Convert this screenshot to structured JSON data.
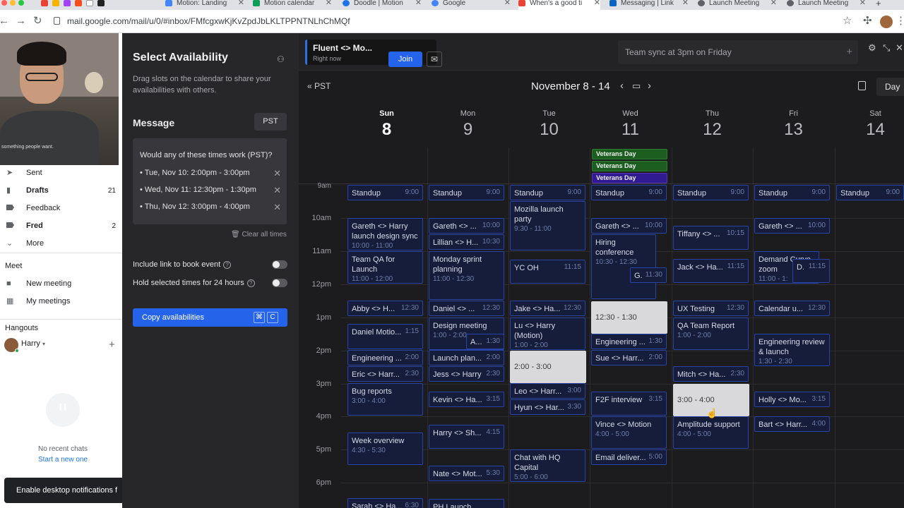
{
  "browser": {
    "tabs": [
      {
        "label": "Motion: Landing",
        "color": "#4285f4"
      },
      {
        "label": "Motion calendar",
        "color": "#0f9d58"
      },
      {
        "label": "Doodle | Motion",
        "color": "#1a73e8"
      },
      {
        "label": "Google",
        "color": "#4285f4"
      },
      {
        "label": "When's a good ti",
        "color": "#ea4335"
      },
      {
        "label": "Messaging | Link",
        "color": "#0a66c2"
      },
      {
        "label": "Launch Meeting",
        "color": "#5f6368"
      },
      {
        "label": "Launch Meeting",
        "color": "#5f6368"
      }
    ],
    "url": "mail.google.com/mail/u/0/#inbox/FMfcgxwKjKvZpdJbLKLTPPNTNLhChMQf"
  },
  "webcam": {
    "shirt_text": "something people want."
  },
  "gmail": {
    "nav": [
      {
        "label": "Sent",
        "count": "",
        "icon": "send-icon"
      },
      {
        "label": "Drafts",
        "count": "21",
        "icon": "draft-icon"
      },
      {
        "label": "Feedback",
        "count": "",
        "icon": "label-icon"
      },
      {
        "label": "Fred",
        "count": "2",
        "icon": "label-icon"
      },
      {
        "label": "More",
        "count": "",
        "icon": "chevron-down-icon"
      }
    ],
    "meet_title": "Meet",
    "meet_items": [
      {
        "label": "New meeting",
        "icon": "video-icon"
      },
      {
        "label": "My meetings",
        "icon": "calendar-icon"
      }
    ],
    "hangouts_title": "Hangouts",
    "hangouts_user": "Harry",
    "no_chats": "No recent chats",
    "start_new": "Start a new one",
    "toast": "Enable desktop notifications f"
  },
  "availability": {
    "title": "Select Availability",
    "description": "Drag slots on the calendar to share your availabilities with others.",
    "message_label": "Message",
    "timezone": "PST",
    "question": "Would any of these times work (PST)?",
    "slots": [
      "• Tue, Nov 10: 2:00pm - 3:00pm",
      "• Wed, Nov 11: 12:30pm - 1:30pm",
      "• Thu, Nov 12: 3:00pm - 4:00pm"
    ],
    "clear_all": "Clear all times",
    "include_link": "Include link to book event",
    "hold_times": "Hold selected times for 24 hours",
    "copy_button": "Copy availabilities",
    "kbd_cmd": "⌘",
    "kbd_c": "C"
  },
  "meeting_card": {
    "title": "Fluent <> Mo...",
    "subtitle": "Right now",
    "join": "Join"
  },
  "quick_input": {
    "placeholder": "Team sync at 3pm on Friday"
  },
  "calendar": {
    "timezone": "PST",
    "week_range": "November 8 - 14",
    "view": "Day",
    "days": [
      {
        "name": "Sun",
        "date": "8"
      },
      {
        "name": "Mon",
        "date": "9"
      },
      {
        "name": "Tue",
        "date": "10"
      },
      {
        "name": "Wed",
        "date": "11"
      },
      {
        "name": "Thu",
        "date": "12"
      },
      {
        "name": "Fri",
        "date": "13"
      },
      {
        "name": "Sat",
        "date": "14"
      }
    ],
    "hours": [
      "9am",
      "10am",
      "11am",
      "12pm",
      "1pm",
      "2pm",
      "3pm",
      "4pm",
      "5pm",
      "6pm"
    ],
    "all_day": [
      {
        "label": "Veterans Day",
        "color": "#1b5e20",
        "border": "#2e7d32"
      },
      {
        "label": "Veterans Day",
        "color": "#1b5e20",
        "border": "#2e7d32"
      },
      {
        "label": "Veterans Day",
        "color": "#311b92",
        "border": "#5e35b1"
      }
    ],
    "events": {
      "sun": [
        {
          "title": "Standup",
          "time": "9:00"
        },
        {
          "title": "Gareth <> Harry launch design sync",
          "time": "10:00 - 11:00"
        },
        {
          "title": "Team QA for Launch",
          "time": "11:00 - 12:00"
        },
        {
          "title": "Abby <> H...",
          "time": "12:30"
        },
        {
          "title": "Daniel Motio...",
          "time": "1:15"
        },
        {
          "title": "Engineering ...",
          "time": "2:00"
        },
        {
          "title": "Eric <> Harr...",
          "time": "2:30"
        },
        {
          "title": "Bug reports",
          "time": "3:00 - 4:00"
        },
        {
          "title": "Week overview",
          "time": "4:30 - 5:30"
        },
        {
          "title": "Sarah <> Ha...",
          "time": "6:30"
        }
      ],
      "mon": [
        {
          "title": "Standup",
          "time": "9:00"
        },
        {
          "title": "Gareth <> ...",
          "time": "10:00"
        },
        {
          "title": "Lillian <> H...",
          "time": "10:30"
        },
        {
          "title": "Monday sprint planning",
          "time": "11:00 - 12:30"
        },
        {
          "title": "Daniel <> ...",
          "time": "12:30"
        },
        {
          "title": "Design meeting",
          "time": "1:00 - 2:00"
        },
        {
          "title": "A...",
          "time": "1:30"
        },
        {
          "title": "Launch plan...",
          "time": "2:00"
        },
        {
          "title": "Jess <> Harry",
          "time": "2:30"
        },
        {
          "title": "Kevin <> Ha...",
          "time": "3:15"
        },
        {
          "title": "Harry <> Sh...",
          "time": "4:15"
        },
        {
          "title": "Nate <> Mot...",
          "time": "5:30"
        },
        {
          "title": "PH Launch",
          "time": ""
        }
      ],
      "tue": [
        {
          "title": "Standup",
          "time": "9:00"
        },
        {
          "title": "Mozilla launch party",
          "time": "9:30 - 11:00"
        },
        {
          "title": "YC OH",
          "time": "11:15"
        },
        {
          "title": "Jake <> Ha...",
          "time": "12:30"
        },
        {
          "title": "Lu <> Harry (Motion)",
          "time": "1:00 - 2:00"
        },
        {
          "title": "2:00 - 3:00",
          "time": ""
        },
        {
          "title": "Leo <> Harr...",
          "time": "3:00"
        },
        {
          "title": "Hyun <> Har...",
          "time": "3:30"
        },
        {
          "title": "Chat with HQ Capital",
          "time": "5:00 - 6:00"
        }
      ],
      "wed": [
        {
          "title": "Standup",
          "time": "9:00"
        },
        {
          "title": "Gareth <> ...",
          "time": "10:00"
        },
        {
          "title": "Hiring conference",
          "time": "10:30 - 12:30"
        },
        {
          "title": "G.",
          "time": "11:30"
        },
        {
          "title": "12:30 - 1:30",
          "time": ""
        },
        {
          "title": "Engineering ...",
          "time": "1:30"
        },
        {
          "title": "Sue <> Harr...",
          "time": "2:00"
        },
        {
          "title": "F2F interview",
          "time": "3:15"
        },
        {
          "title": "Vince <> Motion",
          "time": "4:00 - 5:00"
        },
        {
          "title": "Email deliver...",
          "time": "5:00"
        }
      ],
      "thu": [
        {
          "title": "Standup",
          "time": "9:00"
        },
        {
          "title": "Tiffany <> ...",
          "time": "10:15"
        },
        {
          "title": "Jack <> Ha...",
          "time": "11:15"
        },
        {
          "title": "UX Testing",
          "time": "12:30"
        },
        {
          "title": "QA Team Report",
          "time": "1:00 - 2:00"
        },
        {
          "title": "Mitch <> Ha...",
          "time": "2:30"
        },
        {
          "title": "3:00 - 4:00",
          "time": ""
        },
        {
          "title": "Amplitude support",
          "time": "4:00 - 5:00"
        }
      ],
      "fri": [
        {
          "title": "Standup",
          "time": "9:00"
        },
        {
          "title": "Gareth <> ...",
          "time": "10:00"
        },
        {
          "title": "Demand Curve zoom",
          "time": "11:00 - 1:"
        },
        {
          "title": "D.",
          "time": "11:15"
        },
        {
          "title": "Calendar u...",
          "time": "12:30"
        },
        {
          "title": "Engineering review & launch",
          "time": "1:30 - 2:30"
        },
        {
          "title": "Holly <> Mo...",
          "time": "3:15"
        },
        {
          "title": "Bart <> Harr...",
          "time": "4:00"
        }
      ],
      "sat": [
        {
          "title": "Standup",
          "time": "9:00"
        }
      ]
    }
  }
}
